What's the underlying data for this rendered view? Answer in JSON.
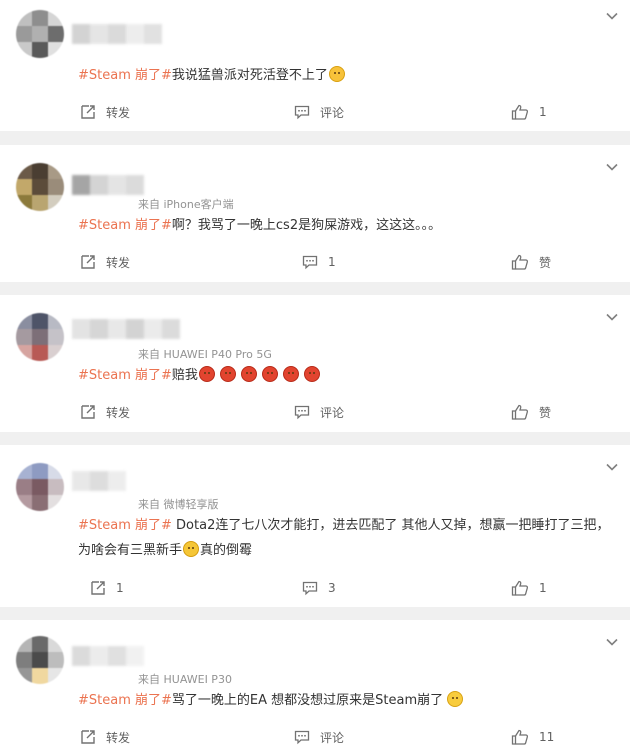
{
  "feed": {
    "posts": [
      {
        "source": "",
        "topic": "#Steam 崩了#",
        "text": "我说猛兽派对死活登不上了",
        "repost_label": "转发",
        "comment_label": "评论",
        "like_label": "1"
      },
      {
        "source": "来自 iPhone客户端",
        "topic": "#Steam 崩了#",
        "text": "啊？我骂了一晚上cs2是狗屎游戏，这这这。。。",
        "repost_label": "转发",
        "comment_label": "1",
        "like_label": "赞"
      },
      {
        "source": "来自 HUAWEI P40 Pro 5G",
        "topic": "#Steam 崩了#",
        "text": "赔我",
        "repost_label": "转发",
        "comment_label": "评论",
        "like_label": "赞"
      },
      {
        "source": "来自 微博轻享版",
        "topic": "#Steam 崩了#",
        "text": " Dota2连了七八次才能打，进去匹配了 其他人又掉，想赢一把睡打了三把，为啥会有三黑新手",
        "text_after": "真的倒霉",
        "repost_label": "1",
        "comment_label": "3",
        "like_label": "1"
      },
      {
        "source": "来自 HUAWEI P30",
        "topic": "#Steam 崩了#",
        "text": "骂了一晚上的EA 想都没想过原来是Steam崩了",
        "repost_label": "转发",
        "comment_label": "评论",
        "like_label": "11"
      }
    ]
  },
  "colors": {
    "topic": "#eb7350",
    "text": "#333333",
    "meta": "#939393",
    "action": "#616161",
    "divider": "#f0f0f0"
  }
}
